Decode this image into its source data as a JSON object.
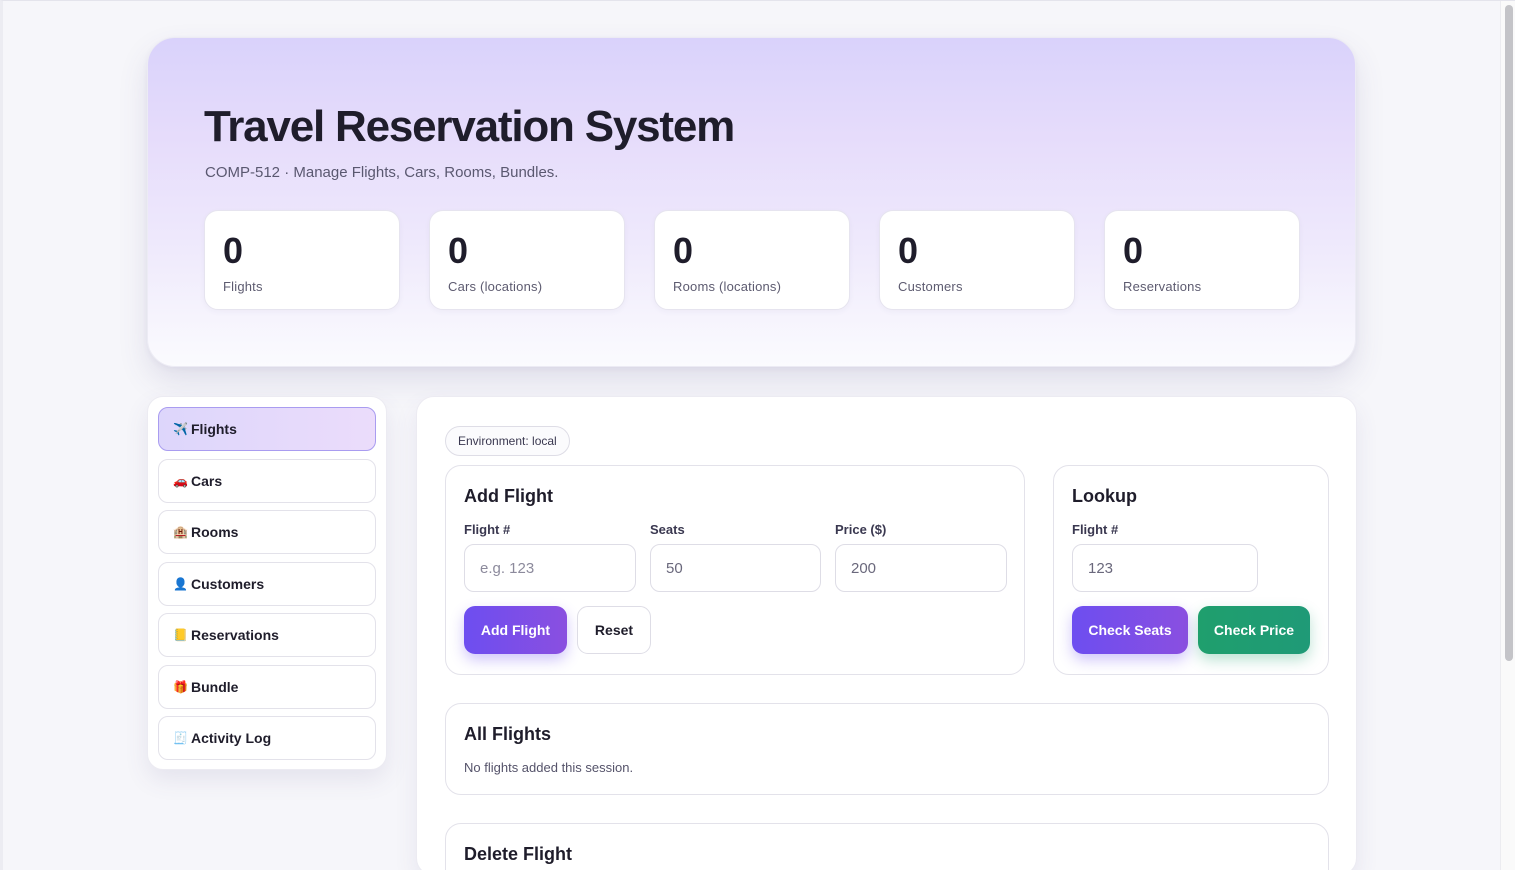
{
  "hero": {
    "title": "Travel Reservation System",
    "subtitle": "COMP-512 · Manage Flights, Cars, Rooms, Bundles.",
    "stats": [
      {
        "value": "0",
        "label": "Flights"
      },
      {
        "value": "0",
        "label": "Cars (locations)"
      },
      {
        "value": "0",
        "label": "Rooms (locations)"
      },
      {
        "value": "0",
        "label": "Customers"
      },
      {
        "value": "0",
        "label": "Reservations"
      }
    ]
  },
  "sidebar": {
    "items": [
      {
        "icon": "✈️",
        "icon_name": "airplane-icon",
        "label": "Flights",
        "active": true
      },
      {
        "icon": "🚗",
        "icon_name": "car-icon",
        "label": "Cars",
        "active": false
      },
      {
        "icon": "🏨",
        "icon_name": "hotel-icon",
        "label": "Rooms",
        "active": false
      },
      {
        "icon": "👤",
        "icon_name": "user-icon",
        "label": "Customers",
        "active": false
      },
      {
        "icon": "📒",
        "icon_name": "ledger-icon",
        "label": "Reservations",
        "active": false
      },
      {
        "icon": "🎁",
        "icon_name": "gift-icon",
        "label": "Bundle",
        "active": false
      },
      {
        "icon": "🧾",
        "icon_name": "receipt-icon",
        "label": "Activity Log",
        "active": false
      }
    ]
  },
  "main": {
    "environment": "Environment: local",
    "add_flight": {
      "title": "Add Flight",
      "flight_label": "Flight #",
      "flight_placeholder": "e.g. 123",
      "seats_label": "Seats",
      "seats_value": "50",
      "price_label": "Price ($)",
      "price_value": "200",
      "add_button": "Add Flight",
      "reset_button": "Reset"
    },
    "lookup": {
      "title": "Lookup",
      "flight_label": "Flight #",
      "flight_value": "123",
      "check_seats_button": "Check Seats",
      "check_price_button": "Check Price"
    },
    "all_flights": {
      "title": "All Flights",
      "empty_text": "No flights added this session."
    },
    "delete_flight": {
      "title": "Delete Flight"
    }
  },
  "colors": {
    "accent": "#6d4ef0",
    "green": "#1f9f6d",
    "text": "#1f1d2b"
  }
}
